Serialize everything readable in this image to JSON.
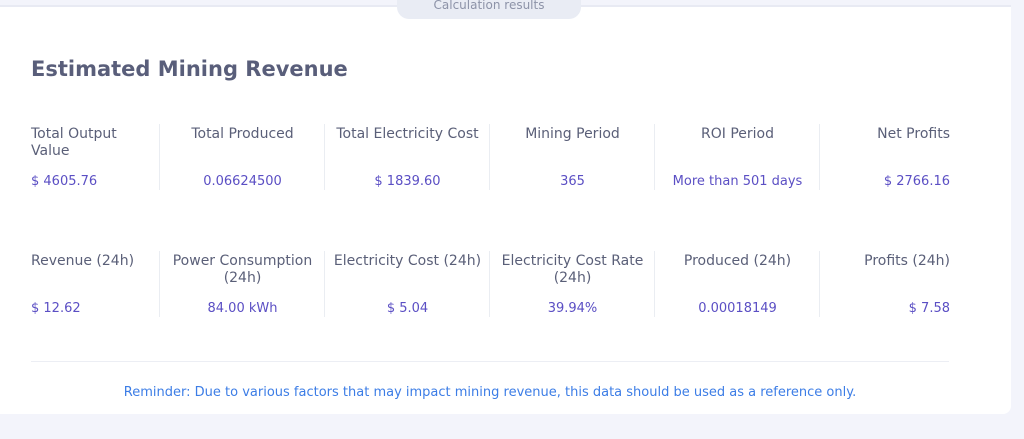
{
  "tab": {
    "label": "Calculation results"
  },
  "title": "Estimated Mining Revenue",
  "summary_stats": [
    {
      "label": "Total Output Value",
      "value": "$ 4605.76"
    },
    {
      "label": "Total Produced",
      "value": "0.06624500"
    },
    {
      "label": "Total Electricity Cost",
      "value": "$ 1839.60"
    },
    {
      "label": "Mining Period",
      "value": "365"
    },
    {
      "label": "ROI Period",
      "value": "More than 501 days"
    },
    {
      "label": "Net Profits",
      "value": "$ 2766.16"
    }
  ],
  "daily_stats": [
    {
      "label": "Revenue (24h)",
      "value": "$ 12.62"
    },
    {
      "label": "Power Consumption (24h)",
      "value": "84.00 kWh"
    },
    {
      "label": "Electricity Cost (24h)",
      "value": "$ 5.04"
    },
    {
      "label": "Electricity Cost Rate (24h)",
      "value": "39.94%"
    },
    {
      "label": "Produced (24h)",
      "value": "0.00018149"
    },
    {
      "label": "Profits (24h)",
      "value": "$ 7.58"
    }
  ],
  "reminder": "Reminder: Due to various factors that may impact mining revenue, this data should be used as a reference only.",
  "colors": {
    "value_text": "#5b4fc4",
    "reminder_text": "#3c7de6",
    "title_text": "#595e7a"
  }
}
